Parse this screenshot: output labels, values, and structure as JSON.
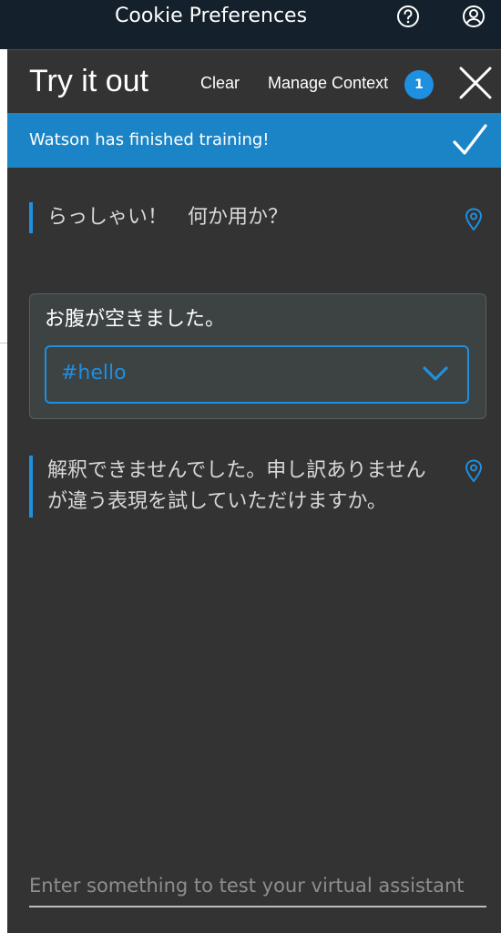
{
  "topbar": {
    "title": "Cookie Preferences",
    "help_icon": "help-circle-icon",
    "user_icon": "user-avatar-icon"
  },
  "panel": {
    "title": "Try it out",
    "clear_label": "Clear",
    "manage_context_label": "Manage Context",
    "context_count": "1",
    "close_icon": "close-icon"
  },
  "banner": {
    "message": "Watson has finished training!",
    "icon": "checkmark-icon"
  },
  "conversation": {
    "bot_greeting": "らっしゃい！　何か用か？",
    "user_message": "お腹が空きました。",
    "detected_intent": "#hello",
    "bot_reply": "解釈できませんでした。申し訳ありませんが違う表現を試していただけますか。"
  },
  "input": {
    "placeholder": "Enter something to test your virtual assistant"
  },
  "colors": {
    "topbar_bg": "#14202b",
    "panel_bg": "#333333",
    "accent": "#1f8fe0",
    "banner_bg": "#1b84c6"
  }
}
